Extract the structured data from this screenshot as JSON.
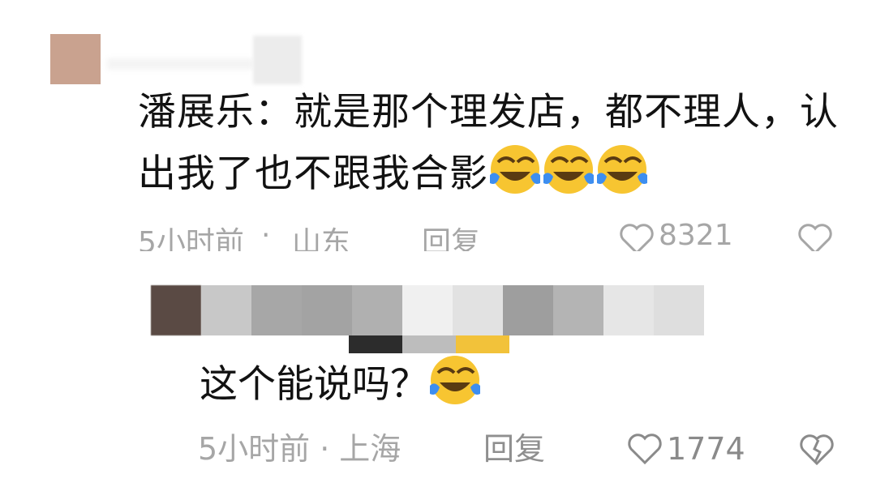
{
  "comment": {
    "author": "潘展乐",
    "separator": "：",
    "text": "就是那个理发店，都不理人，认出我了也不跟我合影",
    "emojis": [
      "laughing-crying-icon",
      "laughing-crying-icon",
      "laughing-crying-icon"
    ],
    "time": "5小时前",
    "location": "山东",
    "reply_label": "回复",
    "likes": "8321"
  },
  "reply": {
    "text": "这个能说吗？",
    "emoji": "laughing-crying-icon",
    "time": "5小时前",
    "dot": "·",
    "location": "上海",
    "reply_label": "回复",
    "likes": "1774"
  },
  "colors": {
    "text": "#121212",
    "meta": "#a6a6a6",
    "emoji_face": "#f7c531",
    "emoji_tear": "#3d8ef0"
  }
}
